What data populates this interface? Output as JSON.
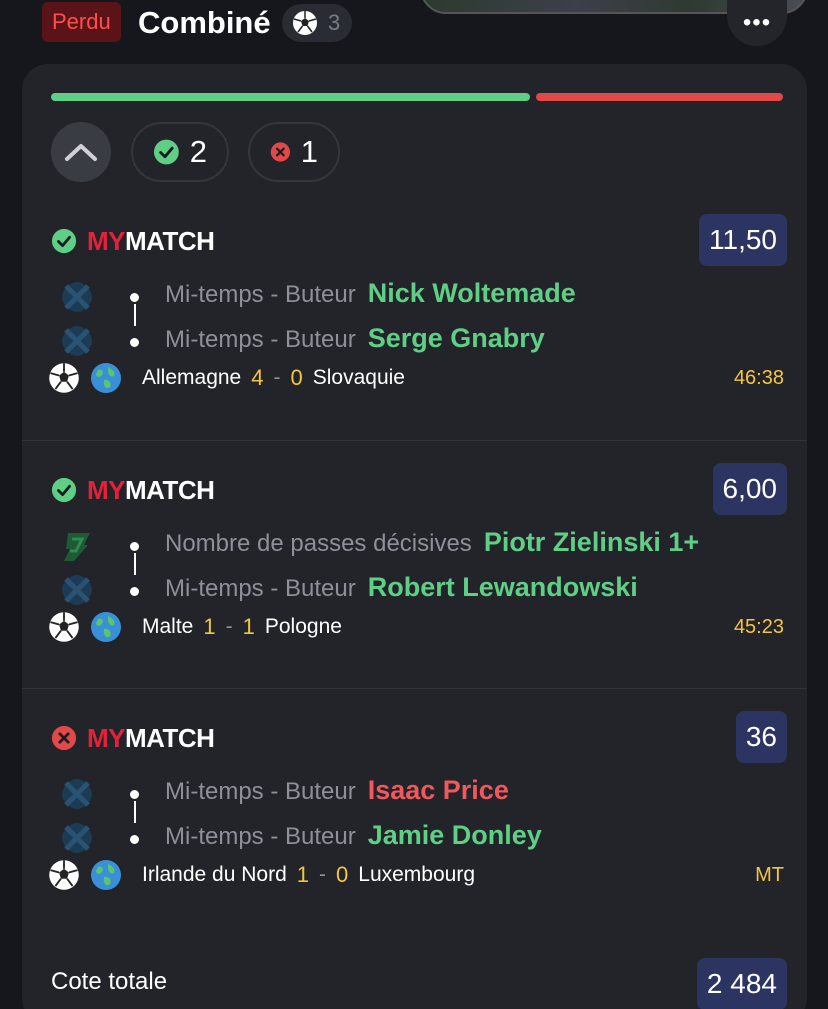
{
  "header": {
    "status": "Perdu",
    "title": "Combiné",
    "sport_count": "3",
    "more_label": "•••"
  },
  "progress": {
    "won_fraction": 0.66,
    "lost_fraction": 0.34
  },
  "counts": {
    "won": "2",
    "lost": "1"
  },
  "logo": {
    "my": "MY",
    "match": "MATCH"
  },
  "sections": [
    {
      "result": "won",
      "odds": "11,50",
      "selections": [
        {
          "market": "Mi-temps - Buteur",
          "player": "Nick Woltemade",
          "player_status": "won",
          "icon": "scorer-icon"
        },
        {
          "market": "Mi-temps - Buteur",
          "player": "Serge Gnabry",
          "player_status": "won",
          "icon": "scorer-icon"
        }
      ],
      "match": {
        "home": "Allemagne",
        "home_score": "4",
        "away_score": "0",
        "away": "Slovaquie",
        "time": "46:38"
      }
    },
    {
      "result": "won",
      "odds": "6,00",
      "selections": [
        {
          "market": "Nombre de passes décisives",
          "player": "Piotr Zielinski 1+",
          "player_status": "won",
          "icon": "assist-icon"
        },
        {
          "market": "Mi-temps - Buteur",
          "player": "Robert Lewandowski",
          "player_status": "won",
          "icon": "scorer-icon"
        }
      ],
      "match": {
        "home": "Malte",
        "home_score": "1",
        "away_score": "1",
        "away": "Pologne",
        "time": "45:23"
      }
    },
    {
      "result": "lost",
      "odds": "36",
      "selections": [
        {
          "market": "Mi-temps - Buteur",
          "player": "Isaac Price",
          "player_status": "lost",
          "icon": "scorer-icon"
        },
        {
          "market": "Mi-temps - Buteur",
          "player": "Jamie Donley",
          "player_status": "won",
          "icon": "scorer-icon"
        }
      ],
      "match": {
        "home": "Irlande du Nord",
        "home_score": "1",
        "away_score": "0",
        "away": "Luxembourg",
        "time": "MT"
      }
    }
  ],
  "total": {
    "label": "Cote totale",
    "value": "2 484"
  },
  "colors": {
    "won": "#5fcf86",
    "lost": "#e14848",
    "odds_bg": "#2c3561",
    "score": "#f4c542"
  }
}
